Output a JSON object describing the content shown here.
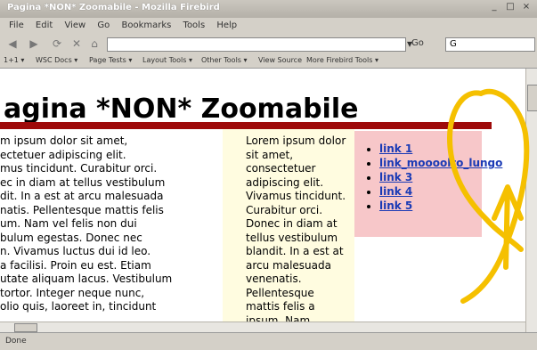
{
  "window": {
    "title": "Pagina *NON* Zoomabile - Mozilla Firebird",
    "controls": [
      "_",
      "□",
      "×"
    ]
  },
  "menubar": {
    "items": [
      "File",
      "Edit",
      "View",
      "Go",
      "Bookmarks",
      "Tools",
      "Help"
    ]
  },
  "navbar": {
    "url_value": "",
    "go_label": "Go",
    "search_value": "G"
  },
  "webdev": {
    "items": [
      "WSC Docs ▾",
      "Page Tests ▾",
      "Layout Tools ▾",
      "Other Tools ▾",
      "View Source",
      "More Firebird Tools ▾"
    ],
    "prefix": "1+1 ▾"
  },
  "page": {
    "heading": "agina *NON* Zoomabile",
    "col1_lines": [
      "m ipsum dolor sit amet,",
      "ectetuer adipiscing elit.",
      "mus tincidunt. Curabitur orci.",
      "ec in diam at tellus vestibulum",
      "dit. In a est at arcu malesuada",
      "natis. Pellentesque mattis felis",
      "um. Nam vel felis non dui",
      "bulum egestas. Donec nec",
      "n. Vivamus luctus dui id leo.",
      "a facilisi. Proin eu est. Etiam",
      "utate aliquam lacus. Vestibulum",
      "tortor. Integer neque nunc,",
      "olio quis, laoreet in, tincidunt"
    ],
    "col2_text": "Lorem ipsum dolor sit amet, consectetuer adipiscing elit. Vivamus tincidunt. Curabitur orci. Donec in diam at tellus vestibulum blandit. In a est at arcu malesuada venenatis. Pellentesque mattis felis a ipsum. Nam",
    "links": [
      "link 1",
      "link_moooolto_lungo",
      "link 3",
      "link 4",
      "link 5"
    ]
  },
  "statusbar": {
    "text": "Done"
  },
  "colors": {
    "accent_red": "#9e0a0a",
    "annotation": "#f5c000"
  }
}
